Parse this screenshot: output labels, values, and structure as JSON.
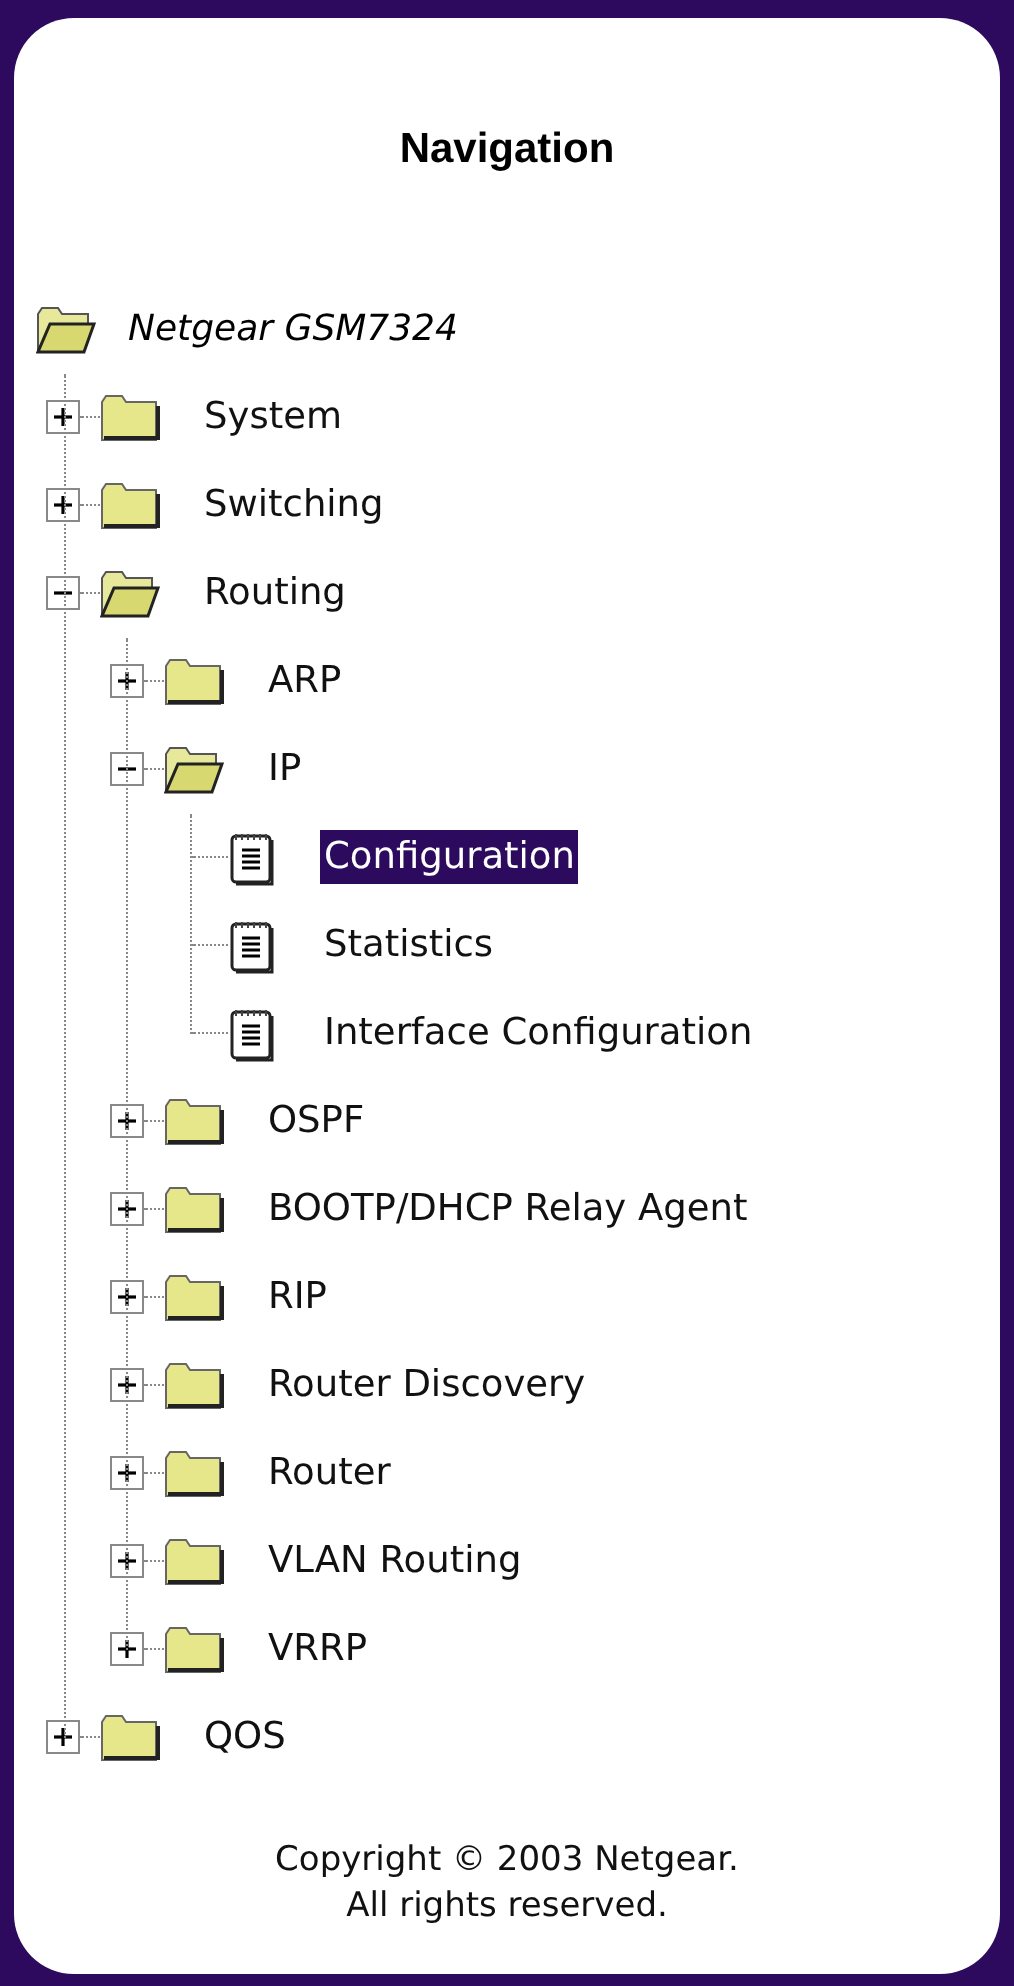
{
  "title": "Navigation",
  "tree": {
    "kind": "root",
    "label": "Netgear GSM7324",
    "expanded": true,
    "children": [
      {
        "kind": "folder",
        "label": "System",
        "expanded": false
      },
      {
        "kind": "folder",
        "label": "Switching",
        "expanded": false
      },
      {
        "kind": "folder",
        "label": "Routing",
        "expanded": true,
        "children": [
          {
            "kind": "folder",
            "label": "ARP",
            "expanded": false
          },
          {
            "kind": "folder",
            "label": "IP",
            "expanded": true,
            "children": [
              {
                "kind": "page",
                "label": "Configuration",
                "selected": true
              },
              {
                "kind": "page",
                "label": "Statistics",
                "selected": false
              },
              {
                "kind": "page",
                "label": "Interface Configuration",
                "selected": false
              }
            ]
          },
          {
            "kind": "folder",
            "label": "OSPF",
            "expanded": false
          },
          {
            "kind": "folder",
            "label": "BOOTP/DHCP Relay Agent",
            "expanded": false
          },
          {
            "kind": "folder",
            "label": "RIP",
            "expanded": false
          },
          {
            "kind": "folder",
            "label": "Router Discovery",
            "expanded": false
          },
          {
            "kind": "folder",
            "label": "Router",
            "expanded": false
          },
          {
            "kind": "folder",
            "label": "VLAN Routing",
            "expanded": false
          },
          {
            "kind": "folder",
            "label": "VRRP",
            "expanded": false
          }
        ]
      },
      {
        "kind": "folder",
        "label": "QOS",
        "expanded": false
      }
    ]
  },
  "copyright": [
    "Copyright © 2003 Netgear.",
    "All rights reserved."
  ]
}
